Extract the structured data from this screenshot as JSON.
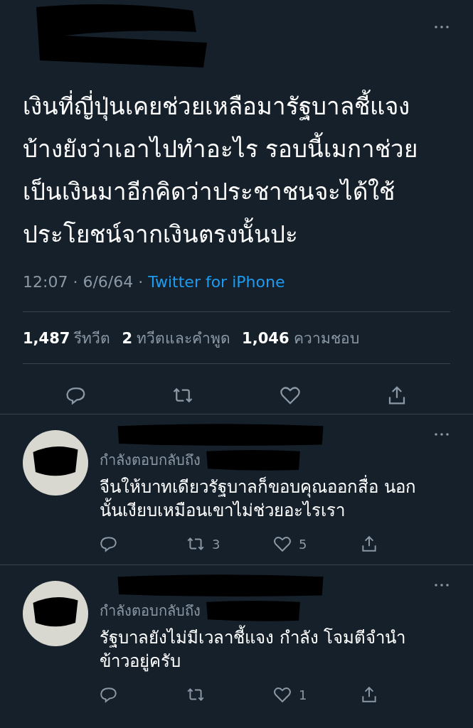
{
  "tweet": {
    "text_lines": [
      "เงินที่ญี่ปุ่นเคยช่วยเหลือมารัฐบาลชี้แจง",
      "บ้างยังว่าเอาไปทำอะไร รอบนี้เมกาช่วย",
      "เป็นเงินมาอีกคิดว่าประชาชนจะได้ใช้",
      "ประโยชน์จากเงินตรงนั้นปะ"
    ],
    "time": "12:07 · 6/6/64 ·",
    "source": "Twitter for iPhone",
    "stats": [
      {
        "count": "1,487",
        "label": "รีทวีต"
      },
      {
        "count": "2",
        "label": "ทวีตและคำพูด"
      },
      {
        "count": "1,046",
        "label": "ความชอบ"
      }
    ]
  },
  "replies": [
    {
      "reply_to": "กำลังตอบกลับถึง",
      "text_lines": [
        "จีนให้บาทเดียวรัฐบาลก็ขอบคุณออกสื่อ นอก",
        "นั้นเงียบเหมือนเขาไม่ช่วยอะไรเรา"
      ],
      "retweets": "3",
      "likes": "5"
    },
    {
      "reply_to": "กำลังตอบกลับถึง",
      "text_lines": [
        "รัฐบาลยังไม่มีเวลาชี้แจง กำลัง โจมตีจำนำ",
        "ข้าวอยู่ครับ"
      ],
      "likes": "1"
    }
  ]
}
